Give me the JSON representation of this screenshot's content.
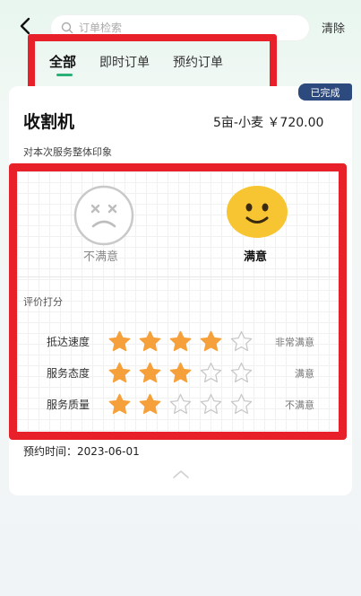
{
  "header": {
    "search_placeholder": "订单检索",
    "clear_label": "清除"
  },
  "tabs": [
    {
      "label": "全部",
      "active": true
    },
    {
      "label": "即时订单",
      "active": false
    },
    {
      "label": "预约订单",
      "active": false
    }
  ],
  "order": {
    "status": "已完成",
    "title": "收割机",
    "info": "5亩-小麦  ￥720.00",
    "impression_label": "对本次服务整体印象",
    "faces": {
      "unhappy_label": "不满意",
      "happy_label": "满意",
      "selected": "满意"
    },
    "score_label": "评价打分",
    "ratings": [
      {
        "label": "抵达速度",
        "stars": 4,
        "max": 5,
        "result": "非常满意"
      },
      {
        "label": "服务态度",
        "stars": 3,
        "max": 5,
        "result": "满意"
      },
      {
        "label": "服务质量",
        "stars": 2,
        "max": 5,
        "result": "不满意"
      }
    ],
    "booking_label": "预约时间：",
    "booking_date": "2023-06-01"
  },
  "colors": {
    "accent": "#2bb07a",
    "star_filled": "#f5a03a",
    "highlight_frame": "#e8202a",
    "badge_bg": "#2c4a7e",
    "happy_face": "#f7c531"
  },
  "icons": {
    "back": "chevron-left-icon",
    "search": "search-icon",
    "collapse": "chevron-up-icon"
  }
}
